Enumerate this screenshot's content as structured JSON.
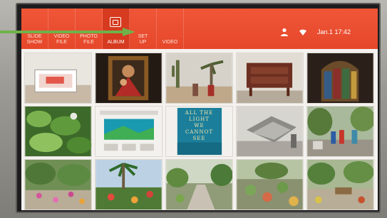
{
  "menu": [
    {
      "label": "SLIDE\nSHOW",
      "name": "menu-slide-show"
    },
    {
      "label": "VIDEO\nFILE",
      "name": "menu-video-file"
    },
    {
      "label": "PHOTO\nFILE",
      "name": "menu-photo-file"
    },
    {
      "label": "ALBUM",
      "name": "menu-album"
    },
    {
      "label": "SET\nUP",
      "name": "menu-setup"
    },
    {
      "label": "VIDEO",
      "name": "menu-video"
    }
  ],
  "status": {
    "time": "Jan.1 17:42",
    "icons": [
      "person-icon",
      "wifi-icon"
    ]
  },
  "accent_color": "#e94c2c",
  "book": {
    "line1": "ALL THE",
    "line2": "LIGHT",
    "line3": "WE",
    "line4": "CANNOT",
    "line5": "SEE"
  },
  "photos": [
    "photo-tablet-on-table",
    "photo-madonna-painting",
    "photo-desert-cactus-figures",
    "photo-wooden-cabinet",
    "photo-stained-glass",
    "photo-green-leaves",
    "photo-video-thumbnails",
    "photo-book-cover",
    "photo-stone-sculpture",
    "photo-garden-people",
    "photo-garden-flowers",
    "photo-palm-garden",
    "photo-stone-path-garden",
    "photo-succulent-garden",
    "photo-garden-bench"
  ]
}
